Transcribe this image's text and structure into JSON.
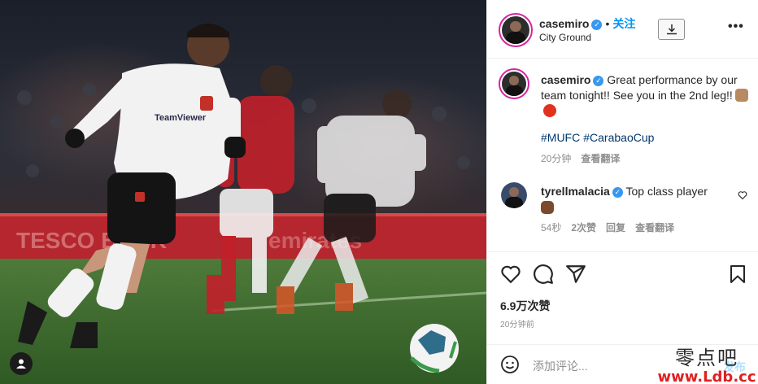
{
  "post": {
    "author": "casemiro",
    "follow_label": "关注",
    "separator": "•",
    "location": "City Ground",
    "more_label": "•••"
  },
  "caption": {
    "author": "casemiro",
    "text": "Great performance by our team tonight!! See you in the 2nd leg!!",
    "hashtags": [
      "#MUFC",
      "#CarabaoCup"
    ],
    "time": "20分钟",
    "translate_label": "查看翻译"
  },
  "comment": {
    "author": "tyrellmalacia",
    "text": "Top class player",
    "time": "54秒",
    "likes": "2次赞",
    "reply_label": "回复",
    "translate_label": "查看翻译"
  },
  "stats": {
    "likes": "6.9万次赞",
    "posted": "20分钟前"
  },
  "composer": {
    "placeholder": "添加评论...",
    "post_label": "发布"
  },
  "watermark": {
    "top": "零点吧",
    "bottom": "www.Ldb.cc"
  },
  "icons": [
    "verified-badge-icon",
    "download-icon",
    "more-options-icon",
    "heart-icon",
    "comment-icon",
    "share-icon",
    "bookmark-icon",
    "emoji-icon",
    "user-tag-icon"
  ],
  "colors": {
    "accent": "#0095f6",
    "verified": "#3897f0",
    "hashtag": "#00376b",
    "muted": "#8e8e8e",
    "watermark_red": "#e02020"
  }
}
